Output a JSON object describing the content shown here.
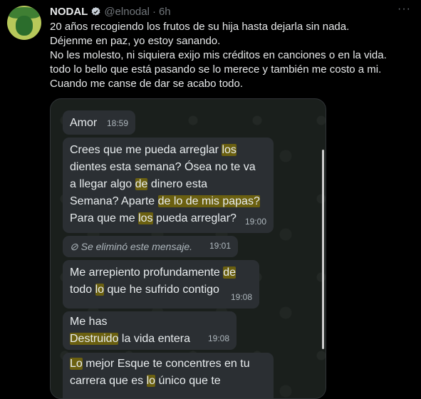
{
  "author": {
    "name": "NODAL",
    "handle": "@elnodal",
    "dot": "·",
    "time": "6h"
  },
  "tweet_lines": [
    "20 años recogiendo los frutos de su hija hasta dejarla sin nada.",
    "Déjenme en paz, yo estoy sanando.",
    "No les molesto, ni siquiera exijo mis créditos en canciones o en la vida.",
    "todo lo bello que está pasando se lo merece y también me costo a mi.",
    "Cuando me canse de dar se acabo todo."
  ],
  "more": "···",
  "chat": {
    "m1": {
      "text": "Amor",
      "time": "18:59"
    },
    "m2": {
      "l1a": "Crees que me pueda arreglar ",
      "l1h": "los",
      "l2a": "dientes esta semana? Ósea no te va",
      "l3a": "a llegar algo ",
      "l3h": "de",
      "l3b": " dinero esta",
      "l4a": "Semana? Aparte ",
      "l4h": "de lo de mis papas?",
      "l5a": "Para que me ",
      "l5h": "los",
      "l5b": " pueda arreglar?",
      "time": "19:00"
    },
    "m3": {
      "text": "Se eliminó este mensaje.",
      "time": "19:01"
    },
    "m4": {
      "l1a": "Me arrepiento profundamente ",
      "l1h": "de",
      "l2a": "todo ",
      "l2h": "lo",
      "l2b": " que he sufrido contigo",
      "time": "19:08"
    },
    "m5": {
      "l1": "Me has",
      "l2h": "Destruido",
      "l2b": " la vida entera",
      "time": "19:08"
    },
    "m6": {
      "l1h": "Lo",
      "l1b": " mejor Esque te concentres en tu",
      "l2a": "carrera que es ",
      "l2h": "lo",
      "l2b": " único que te"
    }
  }
}
